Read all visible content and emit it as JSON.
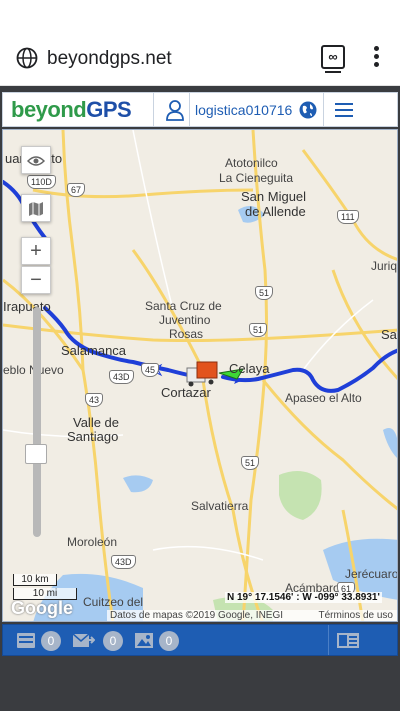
{
  "browser": {
    "url": "beyondgps.net",
    "tab_count_label": "∞",
    "globe_icon": "globe-icon",
    "menu_icon": "more-vert-icon"
  },
  "header": {
    "logo_part1": "beyond",
    "logo_part2": "GPS",
    "username": "logistica010716",
    "user_icon": "user-icon",
    "world_icon": "world-icon",
    "menu_icon": "hamburger-icon"
  },
  "map": {
    "places": {
      "guanajuato": "uanajuato",
      "atotonilco": "Atotonilco",
      "la_cienegita": "La Cieneguita",
      "san_miguel": "San Miguel",
      "de_allende": "de Allende",
      "juriq": "Juriq",
      "irapuato": "Irapuato",
      "santa_cruz_1": "Santa Cruz de",
      "santa_cruz_2": "Juventino",
      "santa_cruz_3": "Rosas",
      "salamanca": "Salamanca",
      "pueblo_nuevo": "eblo Nuevo",
      "cortazar": "Cortazar",
      "celaya": "Celaya",
      "apaseo": "Apaseo el Alto",
      "valle_1": "Valle de",
      "valle_2": "Santiago",
      "salvatierra": "Salvatierra",
      "moroleon": "Moroleón",
      "cuitzeo": "Cuitzeo del",
      "jerecuaro": "Jerécuaro",
      "acambaro": "Acámbaro",
      "sa": "Sa"
    },
    "shields": {
      "r110d": "110D",
      "r67": "67",
      "r111": "111",
      "r51a": "51",
      "r51b": "51",
      "r51c": "51",
      "r43d": "43D",
      "r43": "43",
      "r45": "45",
      "r43d2": "43D",
      "r61": "61"
    },
    "scale_km": "10 km",
    "scale_mi": "10 mi",
    "coordinates": "N 19° 17.1546' : W -099° 33.8931'",
    "attribution": "Datos de mapas ©2019 Google, INEGI",
    "terms": "Términos de uso",
    "google_logo": "Google",
    "controls": {
      "zoom_in": "+",
      "zoom_out": "−",
      "zoom_level": 0.5
    },
    "colors": {
      "route": "#1f3fd8",
      "highway": "#f7d46b",
      "water": "#a6cbf1",
      "park": "#c5e3b1"
    }
  },
  "bottom": {
    "messages_count": "0",
    "sent_count": "0",
    "images_count": "0"
  }
}
